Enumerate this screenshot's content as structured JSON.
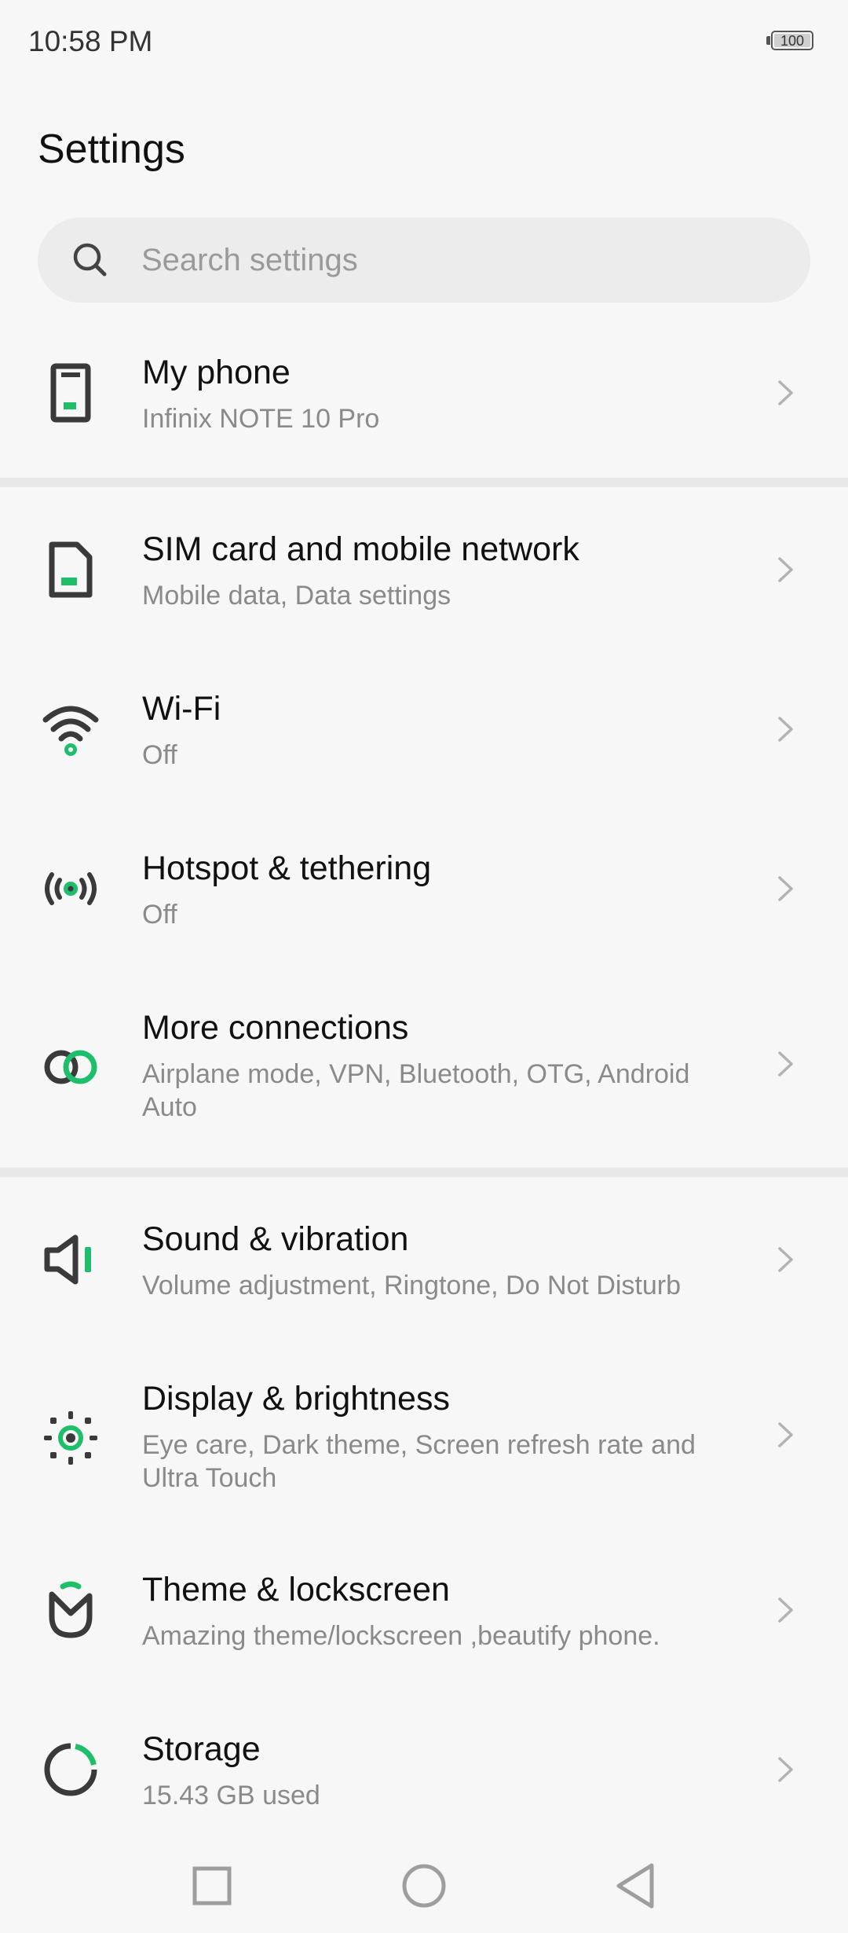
{
  "status_bar": {
    "time": "10:58 PM",
    "battery_level": "100"
  },
  "page": {
    "title": "Settings"
  },
  "search": {
    "placeholder": "Search settings",
    "value": ""
  },
  "items": [
    {
      "title": "My phone",
      "subtitle": "Infinix NOTE 10 Pro",
      "icon": "phone-icon"
    },
    {
      "title": "SIM card and mobile network",
      "subtitle": "Mobile data, Data settings",
      "icon": "sim-card-icon"
    },
    {
      "title": "Wi-Fi",
      "subtitle": "Off",
      "icon": "wifi-icon"
    },
    {
      "title": "Hotspot & tethering",
      "subtitle": "Off",
      "icon": "hotspot-icon"
    },
    {
      "title": "More connections",
      "subtitle": "Airplane mode, VPN, Bluetooth, OTG, Android Auto",
      "icon": "link-icon"
    },
    {
      "title": "Sound & vibration",
      "subtitle": "Volume adjustment, Ringtone, Do Not Disturb",
      "icon": "speaker-icon"
    },
    {
      "title": "Display & brightness",
      "subtitle": "Eye care, Dark theme, Screen refresh rate and Ultra Touch",
      "icon": "brightness-icon"
    },
    {
      "title": "Theme & lockscreen",
      "subtitle": "Amazing theme/lockscreen ,beautify phone.",
      "icon": "theme-icon"
    },
    {
      "title": "Storage",
      "subtitle": "15.43 GB used",
      "icon": "storage-icon"
    }
  ],
  "colors": {
    "accent": "#1dbf6b",
    "icon_dark": "#3a3a3a",
    "background": "#f7f7f7"
  },
  "nav_bar": {
    "icons": [
      "recents-square-icon",
      "home-circle-icon",
      "back-triangle-icon"
    ]
  }
}
